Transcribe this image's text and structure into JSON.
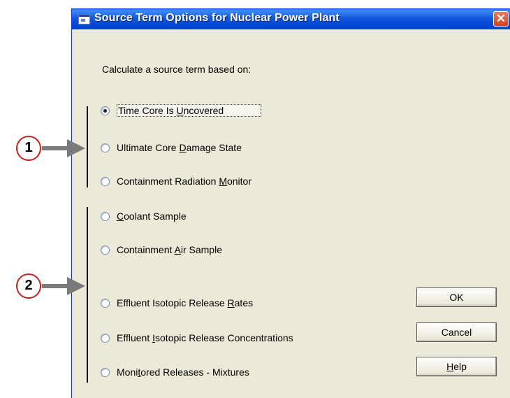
{
  "window": {
    "title": "Source Term Options for Nuclear Power Plant",
    "close_glyph": "✕"
  },
  "prompt": "Calculate a source term based on:",
  "options": [
    {
      "before": "Time Core Is ",
      "accel": "U",
      "after": "ncovered",
      "selected": true
    },
    {
      "before": "Ultimate Core ",
      "accel": "D",
      "after": "amage State",
      "selected": false
    },
    {
      "before": "Containment Radiation ",
      "accel": "M",
      "after": "onitor",
      "selected": false
    },
    {
      "before": "",
      "accel": "C",
      "after": "oolant Sample",
      "selected": false
    },
    {
      "before": "Containment ",
      "accel": "A",
      "after": "ir Sample",
      "selected": false
    },
    {
      "before": "Effluent Isotopic Release ",
      "accel": "R",
      "after": "ates",
      "selected": false
    },
    {
      "before": "Effluent ",
      "accel": "I",
      "after": "sotopic Release Concentrations",
      "selected": false
    },
    {
      "before": "Moni",
      "accel": "t",
      "after": "ored Releases - Mixtures",
      "selected": false
    }
  ],
  "buttons": {
    "ok": "OK",
    "cancel": "Cancel",
    "help_accel": "H",
    "help_rest": "elp"
  },
  "callouts": {
    "one": "1",
    "two": "2"
  },
  "colors": {
    "titlebar": "#0054e3",
    "dialog_bg": "#ece9d8",
    "close_button": "#d94a29",
    "callout_ring": "#c52020",
    "arrow": "#7a7a7a"
  }
}
